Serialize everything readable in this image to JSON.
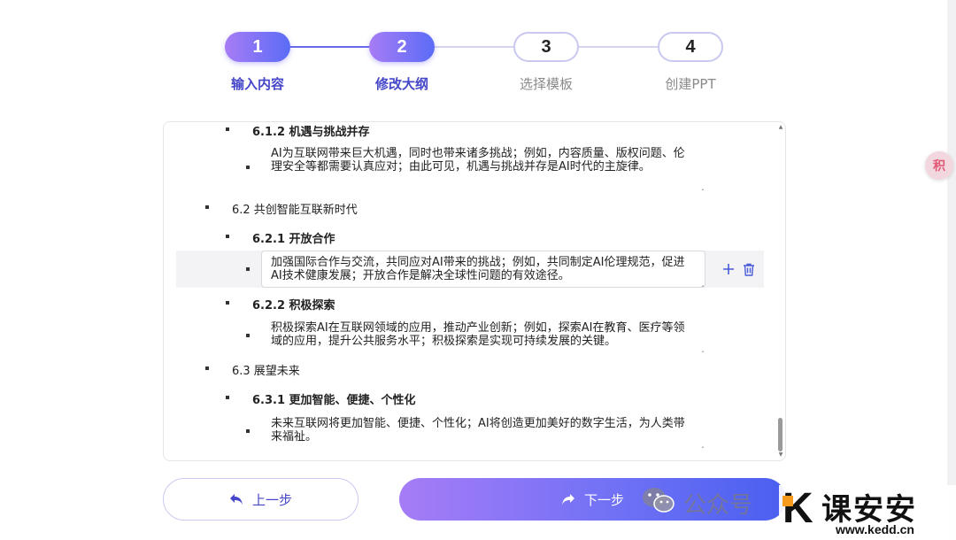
{
  "stepper": {
    "steps": [
      {
        "number": "1",
        "label": "输入内容",
        "state": "completed"
      },
      {
        "number": "2",
        "label": "修改大纲",
        "state": "current"
      },
      {
        "number": "3",
        "label": "选择模板",
        "state": "pending"
      },
      {
        "number": "4",
        "label": "创建PPT",
        "state": "pending"
      }
    ],
    "colors": {
      "active": "#5b6cf6",
      "active_label": "#4646c8",
      "inactive_label": "#8a8a8a",
      "line_done": "#6a6ae8",
      "line_pending": "#d4d4f0"
    }
  },
  "outline": {
    "items": [
      {
        "type": "heading",
        "level": 3,
        "text": "6.1.2 机遇与挑战并存"
      },
      {
        "type": "body",
        "text": "AI为互联网带来巨大机遇，同时也带来诸多挑战；例如，内容质量、版权问题、伦理安全等都需要认真应对；由此可见，机遇与挑战并存是AI时代的主旋律。"
      },
      {
        "type": "heading",
        "level": 2,
        "text": "6.2 共创智能互联新时代"
      },
      {
        "type": "heading",
        "level": 3,
        "text": "6.2.1 开放合作"
      },
      {
        "type": "body",
        "text": "加强国际合作与交流，共同应对AI带来的挑战；例如，共同制定AI伦理规范，促进AI技术健康发展；开放合作是解决全球性问题的有效途径。",
        "focused": true
      },
      {
        "type": "heading",
        "level": 3,
        "text": "6.2.2 积极探索"
      },
      {
        "type": "body",
        "text": "积极探索AI在互联网领域的应用，推动产业创新；例如，探索AI在教育、医疗等领域的应用，提升公共服务水平；积极探索是实现可持续发展的关键。"
      },
      {
        "type": "heading",
        "level": 2,
        "text": "6.3 展望未来"
      },
      {
        "type": "heading",
        "level": 3,
        "text": "6.3.1 更加智能、便捷、个性化"
      },
      {
        "type": "body",
        "text": "未来互联网将更加智能、便捷、个性化；AI将创造更加美好的数字生活，为人类带来福祉。"
      }
    ],
    "row_actions": {
      "add_icon": "plus-icon",
      "delete_icon": "trash-icon"
    }
  },
  "buttons": {
    "prev_label": "上一步",
    "prev_icon": "undo-arrow-icon",
    "next_label": "下一步",
    "next_icon": "redo-arrow-icon"
  },
  "side": {
    "translate_glyph": "积",
    "translate_icon": "translate-icon"
  },
  "watermark": {
    "wechat_text": "公众号",
    "brand_k": "K",
    "brand_text": "课安安",
    "brand_url": "www.kedd.cn"
  }
}
